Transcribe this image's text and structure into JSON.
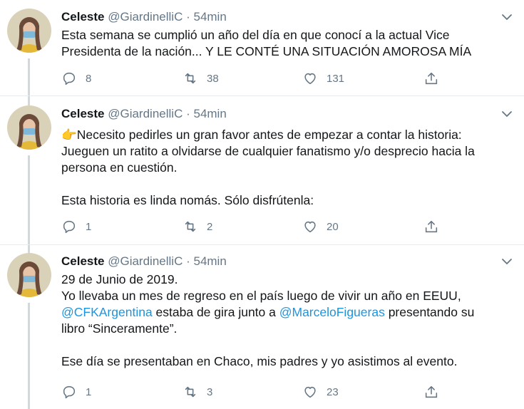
{
  "tweets": [
    {
      "author_name": "Celeste",
      "handle": "@GiardinelliC",
      "dot": "·",
      "time": "54min",
      "lines": [
        "Esta semana se cumplió un año del día en que conocí a la actual Vice",
        "Presidenta de la nación... Y LE CONTÉ UNA SITUACIÓN AMOROSA MÍA"
      ],
      "replies": "8",
      "retweets": "38",
      "likes": "131"
    },
    {
      "author_name": "Celeste",
      "handle": "@GiardinelliC",
      "dot": "·",
      "time": "54min",
      "lines": [
        "Necesito pedirles un gran favor antes de empezar a contar la historia:",
        "Jueguen un ratito a olvidarse de cualquier fanatismo y/o desprecio hacia la",
        "persona en cuestión.",
        "",
        "Esta historia es linda nomás. Sólo disfrútenla:"
      ],
      "emoji": "👉",
      "replies": "1",
      "retweets": "2",
      "likes": "20"
    },
    {
      "author_name": "Celeste",
      "handle": "@GiardinelliC",
      "dot": "·",
      "time": "54min",
      "line1": "29 de Junio de 2019.",
      "line2": "Yo llevaba un mes de regreso en el país luego de vivir un año en EEUU,",
      "mention1": "@CFKArgentina",
      "line3_mid": " estaba de gira junto a ",
      "mention2": "@MarceloFigueras",
      "line3_end": " presentando su",
      "line4": "libro “Sinceramente”.",
      "line5": "",
      "line6": "Ese día se presentaban en Chaco, mis padres y yo asistimos al evento.",
      "replies": "1",
      "retweets": "3",
      "likes": "23"
    }
  ],
  "colors": {
    "accent": "#1b95e0",
    "muted": "#657786",
    "thread_line": "#cfd9de"
  },
  "icons": [
    "reply-icon",
    "retweet-icon",
    "like-icon",
    "share-icon",
    "chevron-down-icon"
  ]
}
